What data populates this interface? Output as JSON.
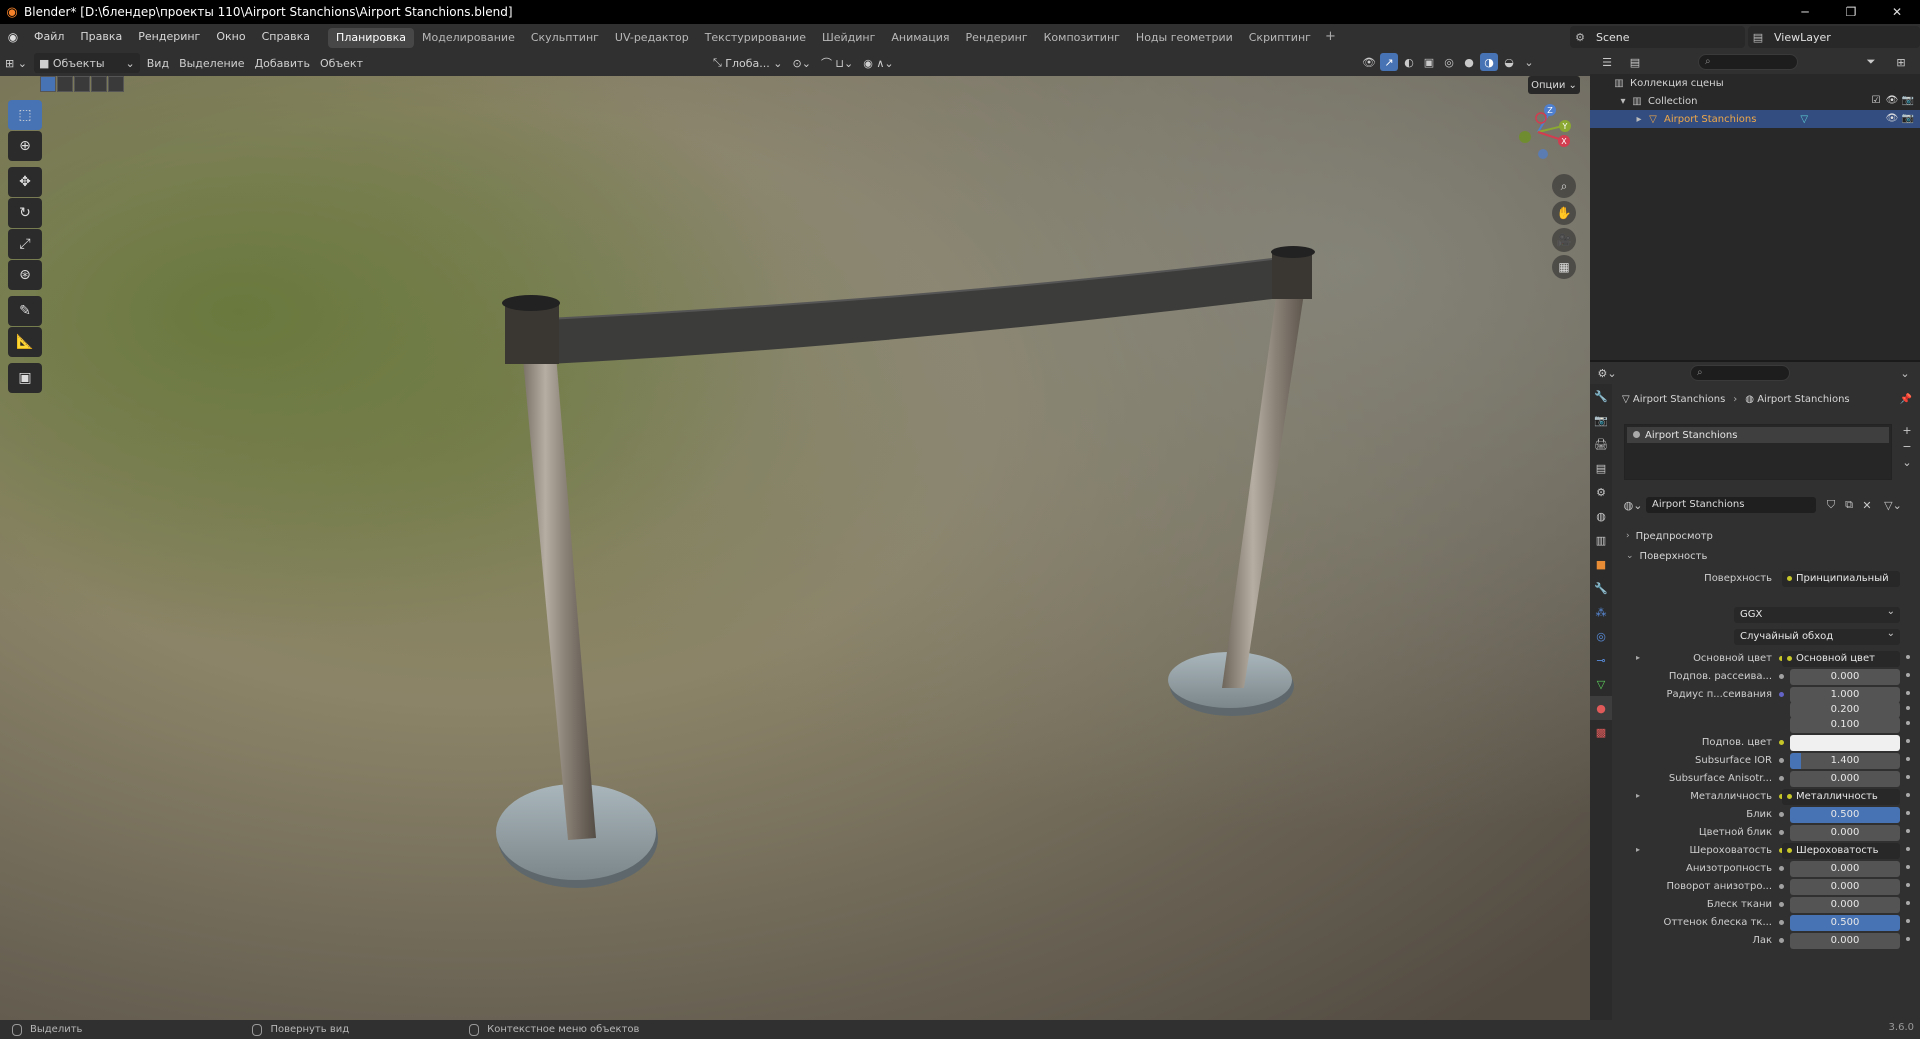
{
  "title": "Blender* [D:\\блендер\\проекты 110\\Airport Stanchions\\Airport Stanchions.blend]",
  "menu": [
    "Файл",
    "Правка",
    "Рендеринг",
    "Окно",
    "Справка"
  ],
  "workspaces": [
    "Планировка",
    "Моделирование",
    "Скульптинг",
    "UV-редактор",
    "Текстурирование",
    "Шейдинг",
    "Анимация",
    "Рендеринг",
    "Композитинг",
    "Ноды геометрии",
    "Скриптинг"
  ],
  "active_workspace": "Планировка",
  "scene": "Scene",
  "view_layer": "ViewLayer",
  "viewport_header": {
    "mode": "Объекты",
    "view": "Вид",
    "select": "Выделение",
    "add": "Добавить",
    "object": "Объект",
    "orientation": "Глоба...",
    "options": "Опции"
  },
  "gizmo": {
    "z": "Z",
    "y": "Y",
    "x": "X"
  },
  "outliner": {
    "scene_collection": "Коллекция сцены",
    "collection": "Collection",
    "object": "Airport Stanchions"
  },
  "properties": {
    "breadcrumb_object": "Airport Stanchions",
    "breadcrumb_material": "Airport Stanchions",
    "slot": "Airport Stanchions",
    "material_name": "Airport Stanchions",
    "panel_preview": "Предпросмотр",
    "panel_surface": "Поверхность",
    "surface_label": "Поверхность",
    "surface_value": "Принципиальный BSDF",
    "distribution": "GGX",
    "subsurface_method": "Случайный обход",
    "rows": [
      {
        "label": "Основной цвет",
        "value": "Основной цвет",
        "kind": "link",
        "expand": true
      },
      {
        "label": "Подпов. рассеива...",
        "value": "0.000",
        "kind": "num"
      },
      {
        "label": "Радиус п...сеивания",
        "value": "1.000",
        "kind": "num",
        "dot": "v"
      },
      {
        "label": "",
        "value": "0.200",
        "kind": "num",
        "nodot": true
      },
      {
        "label": "",
        "value": "0.100",
        "kind": "num",
        "nodot": true
      },
      {
        "label": "Подпов. цвет",
        "value": "",
        "kind": "white",
        "dot": "y"
      },
      {
        "label": "Subsurface IOR",
        "value": "1.400",
        "kind": "num",
        "fill": 0.1
      },
      {
        "label": "Subsurface Anisotr...",
        "value": "0.000",
        "kind": "num"
      },
      {
        "label": "Металличность",
        "value": "Металличность",
        "kind": "link",
        "expand": true
      },
      {
        "label": "Блик",
        "value": "0.500",
        "kind": "num",
        "fill": 1.0
      },
      {
        "label": "Цветной блик",
        "value": "0.000",
        "kind": "num"
      },
      {
        "label": "Шероховатость",
        "value": "Шероховатость",
        "kind": "link",
        "expand": true
      },
      {
        "label": "Анизотропность",
        "value": "0.000",
        "kind": "num"
      },
      {
        "label": "Поворот анизотро...",
        "value": "0.000",
        "kind": "num"
      },
      {
        "label": "Блеск ткани",
        "value": "0.000",
        "kind": "num"
      },
      {
        "label": "Оттенок блеска тк...",
        "value": "0.500",
        "kind": "num",
        "fill": 1.0
      },
      {
        "label": "Лак",
        "value": "0.000",
        "kind": "num"
      }
    ]
  },
  "status": {
    "select": "Выделить",
    "rotate": "Повернуть вид",
    "context": "Контекстное меню объектов",
    "version": "3.6.0"
  }
}
